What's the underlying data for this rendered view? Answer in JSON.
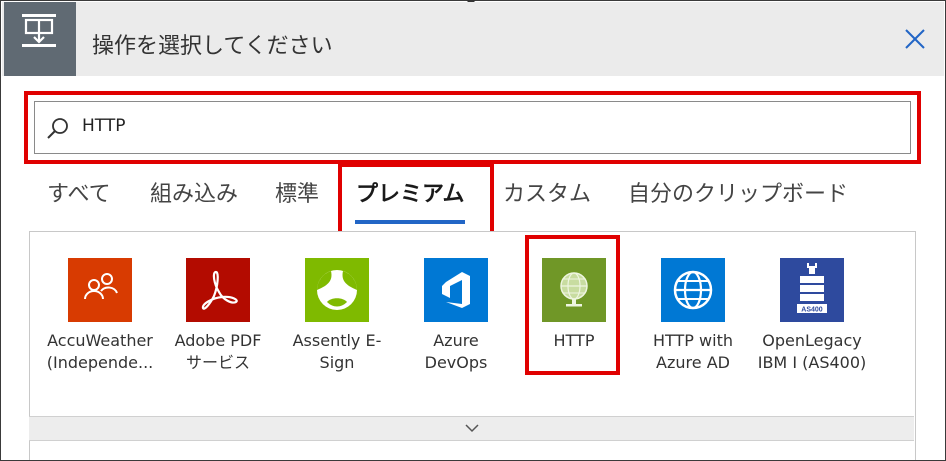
{
  "dialog": {
    "title": "操作を選択してください"
  },
  "search": {
    "value": "HTTP"
  },
  "tabs": [
    {
      "label": "すべて"
    },
    {
      "label": "組み込み"
    },
    {
      "label": "標準"
    },
    {
      "label": "プレミアム",
      "active": true
    },
    {
      "label": "カスタム"
    },
    {
      "label": "自分のクリップボード"
    }
  ],
  "connectors": [
    {
      "line1": "AccuWeather",
      "line2": "(Independe...",
      "icon": "accuweather-icon",
      "color": "#d83b01"
    },
    {
      "line1": "Adobe PDF",
      "line2": "サービス",
      "icon": "adobe-pdf-icon",
      "color": "#b30b00"
    },
    {
      "line1": "Assently E-",
      "line2": "Sign",
      "icon": "assently-icon",
      "color": "#7fba00"
    },
    {
      "line1": "Azure",
      "line2": "DevOps",
      "icon": "azure-devops-icon",
      "color": "#0078d4"
    },
    {
      "line1": "HTTP",
      "line2": "",
      "icon": "http-globe-icon",
      "color": "#709727"
    },
    {
      "line1": "HTTP with",
      "line2": "Azure AD",
      "icon": "globe-icon",
      "color": "#0078d4"
    },
    {
      "line1": "OpenLegacy",
      "line2": "IBM I (AS400)",
      "icon": "server-icon",
      "color": "#2e4a9e",
      "badge": "AS400"
    }
  ],
  "colors": {
    "highlight": "#e00000",
    "accent": "#2266c6",
    "header_icon_bg": "#606a73"
  }
}
